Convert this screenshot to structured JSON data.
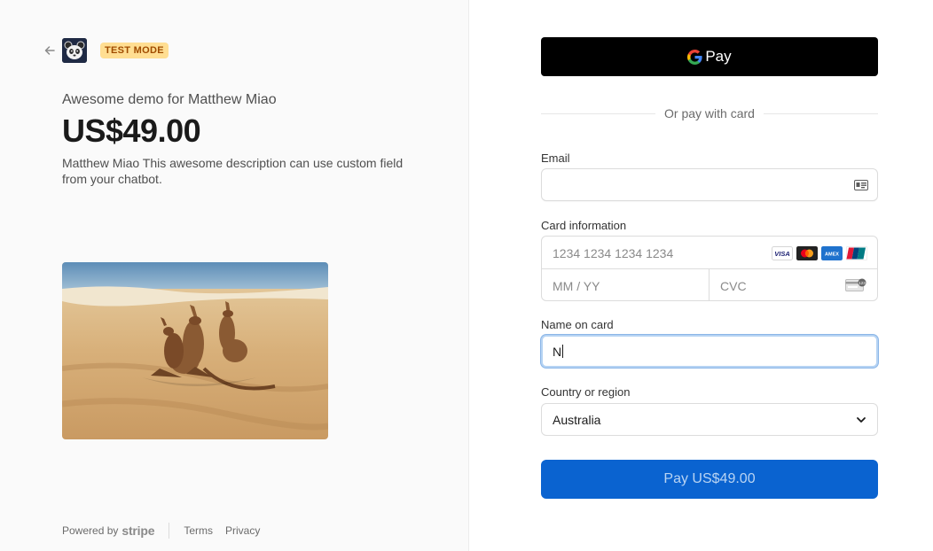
{
  "header": {
    "badge": "TEST MODE"
  },
  "product": {
    "name": "Awesome demo for Matthew Miao",
    "price": "US$49.00",
    "description": "Matthew Miao This awesome description can use custom field from your chatbot."
  },
  "footer": {
    "powered_by": "Powered by",
    "brand": "stripe",
    "terms": "Terms",
    "privacy": "Privacy"
  },
  "payment": {
    "gpay_label": "Pay",
    "divider_text": "Or pay with card",
    "email": {
      "label": "Email",
      "value": ""
    },
    "card": {
      "label": "Card information",
      "number_placeholder": "1234 1234 1234 1234",
      "expiry_placeholder": "MM / YY",
      "cvc_placeholder": "CVC",
      "brands": [
        "visa",
        "mastercard",
        "amex",
        "unionpay"
      ]
    },
    "name": {
      "label": "Name on card",
      "value": "N"
    },
    "country": {
      "label": "Country or region",
      "value": "Australia"
    },
    "pay_button": "Pay US$49.00"
  },
  "colors": {
    "pay_button": "#0a63d0",
    "badge_bg": "#ffde92",
    "badge_text": "#a04c00",
    "focus_ring": "#8bb6e8"
  }
}
